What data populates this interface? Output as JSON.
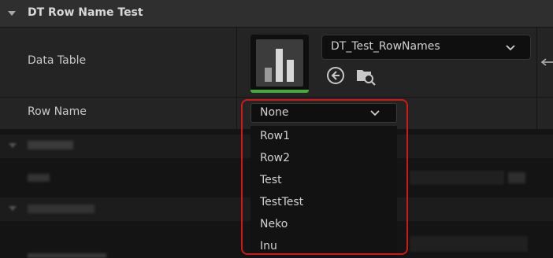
{
  "category": {
    "title": "DT Row Name Test"
  },
  "properties": [
    {
      "label": "Data Table"
    },
    {
      "label": "Row Name"
    }
  ],
  "asset_picker": {
    "value": "DT_Test_RowNames",
    "thumbnail_icon": "bar-chart-icon"
  },
  "row_name": {
    "selected": "None",
    "options": [
      "Row1",
      "Row2",
      "Test",
      "TestTest",
      "Neko",
      "Inu"
    ]
  },
  "colors": {
    "highlight": "#d01818",
    "asset_accent": "#46aa3c"
  }
}
